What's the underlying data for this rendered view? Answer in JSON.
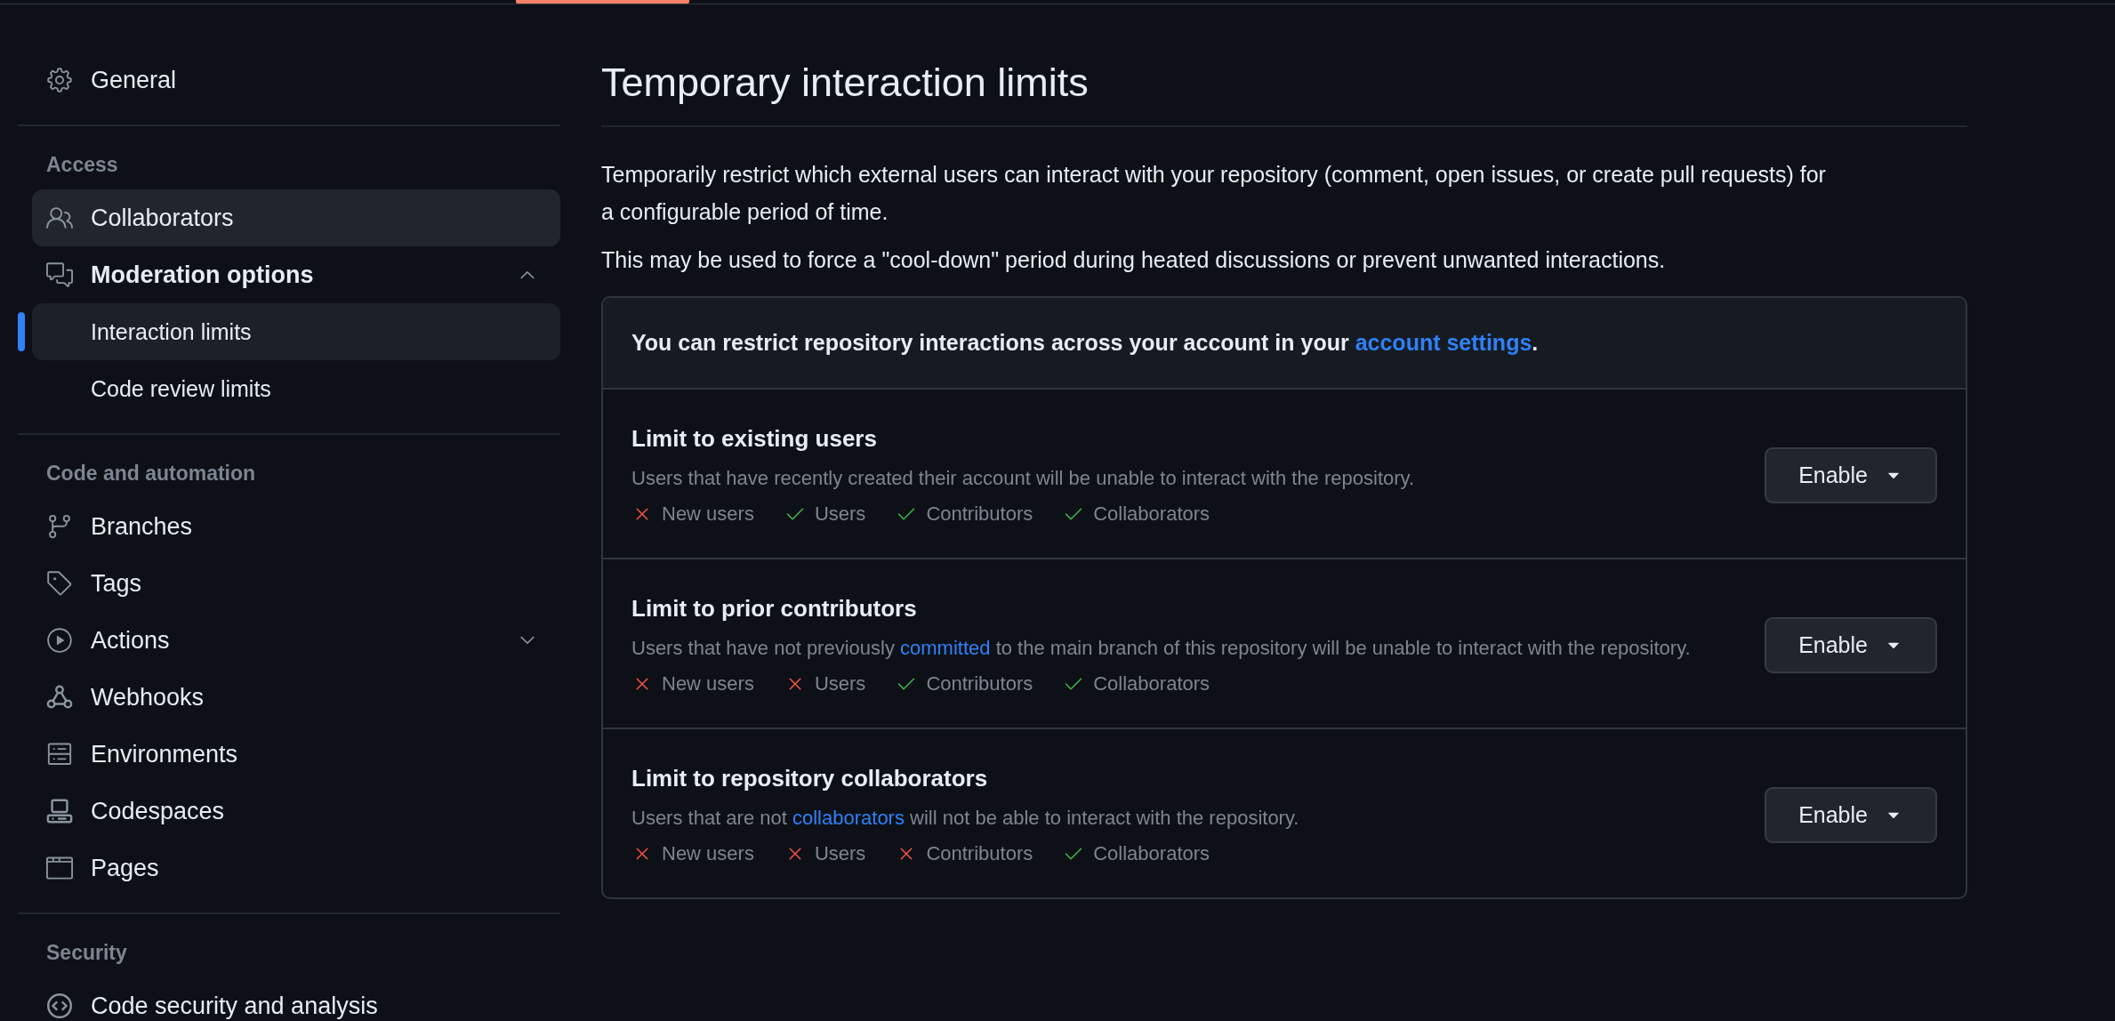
{
  "sidebar": {
    "groups": [
      {
        "items": [
          {
            "label": "General",
            "highlighted": false
          }
        ]
      },
      {
        "heading": "Access",
        "items": [
          {
            "label": "Collaborators",
            "highlighted": true
          },
          {
            "label": "Moderation options",
            "highlighted": false,
            "expanded": true,
            "children": [
              {
                "label": "Interaction limits",
                "selected": true
              },
              {
                "label": "Code review limits",
                "selected": false
              }
            ]
          }
        ]
      },
      {
        "heading": "Code and automation",
        "items": [
          {
            "label": "Branches",
            "highlighted": false
          },
          {
            "label": "Tags",
            "highlighted": false
          },
          {
            "label": "Actions",
            "highlighted": false,
            "expanded": false
          },
          {
            "label": "Webhooks",
            "highlighted": false
          },
          {
            "label": "Environments",
            "highlighted": false
          },
          {
            "label": "Codespaces",
            "highlighted": false
          },
          {
            "label": "Pages",
            "highlighted": false
          }
        ]
      },
      {
        "heading": "Security",
        "items": [
          {
            "label": "Code security and analysis",
            "highlighted": false
          }
        ]
      }
    ]
  },
  "main": {
    "title": "Temporary interaction limits",
    "paragraphs": [
      "Temporarily restrict which external users can interact with your repository (comment, open issues, or create pull requests) for a configurable period of time.",
      "This may be used to force a \"cool-down\" period during heated discussions or prevent unwanted interactions."
    ],
    "notice": [
      {
        "text": "You can restrict repository interactions across your account in your "
      },
      {
        "text": "account settings",
        "link": true
      },
      {
        "text": "."
      }
    ],
    "limits": [
      {
        "title": "Limit to existing users",
        "description": [
          {
            "text": "Users that have recently created their account will be unable to interact with the repository."
          }
        ],
        "audiences": [
          {
            "label": "New users",
            "allowed": false
          },
          {
            "label": "Users",
            "allowed": true
          },
          {
            "label": "Contributors",
            "allowed": true
          },
          {
            "label": "Collaborators",
            "allowed": true
          }
        ],
        "button": "Enable"
      },
      {
        "title": "Limit to prior contributors",
        "description": [
          {
            "text": "Users that have not previously "
          },
          {
            "text": "committed",
            "link": true
          },
          {
            "text": " to the main branch of this repository will be unable to interact with the repository."
          }
        ],
        "audiences": [
          {
            "label": "New users",
            "allowed": false
          },
          {
            "label": "Users",
            "allowed": false
          },
          {
            "label": "Contributors",
            "allowed": true
          },
          {
            "label": "Collaborators",
            "allowed": true
          }
        ],
        "button": "Enable"
      },
      {
        "title": "Limit to repository collaborators",
        "description": [
          {
            "text": "Users that are not "
          },
          {
            "text": "collaborators",
            "link": true
          },
          {
            "text": " will not be able to interact with the repository."
          }
        ],
        "audiences": [
          {
            "label": "New users",
            "allowed": false
          },
          {
            "label": "Users",
            "allowed": false
          },
          {
            "label": "Contributors",
            "allowed": false
          },
          {
            "label": "Collaborators",
            "allowed": true
          }
        ],
        "button": "Enable"
      }
    ]
  }
}
